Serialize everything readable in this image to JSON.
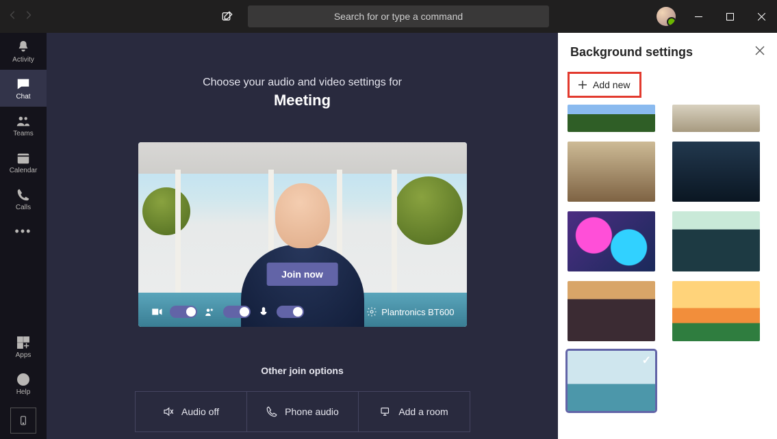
{
  "search": {
    "placeholder": "Search for or type a command"
  },
  "rail": {
    "items": [
      {
        "label": "Activity"
      },
      {
        "label": "Chat"
      },
      {
        "label": "Teams"
      },
      {
        "label": "Calendar"
      },
      {
        "label": "Calls"
      }
    ],
    "bottom": [
      {
        "label": "Apps"
      },
      {
        "label": "Help"
      }
    ]
  },
  "meeting": {
    "pretitle": "Choose your audio and video settings for",
    "title": "Meeting",
    "join": "Join now",
    "device": "Plantronics BT600",
    "other_label": "Other join options",
    "options": [
      {
        "label": "Audio off"
      },
      {
        "label": "Phone audio"
      },
      {
        "label": "Add a room"
      }
    ]
  },
  "panel": {
    "title": "Background settings",
    "add_new": "Add new",
    "thumbs": [
      {
        "name": "meadow",
        "cls": "bg-meadow top"
      },
      {
        "name": "desert",
        "cls": "bg-desert top"
      },
      {
        "name": "village",
        "cls": "bg-village"
      },
      {
        "name": "scifi",
        "cls": "bg-scifi"
      },
      {
        "name": "nebula",
        "cls": "bg-nebula"
      },
      {
        "name": "alien",
        "cls": "bg-alien"
      },
      {
        "name": "street",
        "cls": "bg-street"
      },
      {
        "name": "sunset",
        "cls": "bg-sunset"
      },
      {
        "name": "pool",
        "cls": "bg-pool",
        "selected": true
      }
    ]
  }
}
